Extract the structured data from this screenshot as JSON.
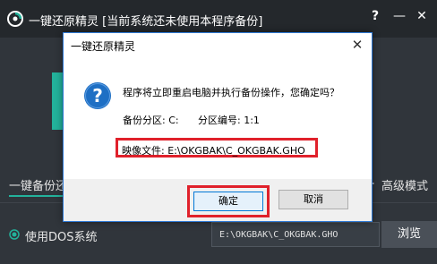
{
  "app": {
    "title": "一键还原精灵 [当前系统还未使用本程序备份]",
    "help_glyph": "?",
    "minimize_glyph": "—",
    "close_glyph": "✕"
  },
  "main": {
    "mode_tab": "一键备份还",
    "advanced_mode": "高级模式",
    "dos_option": "使用DOS系统",
    "image_path": "E:\\OKGBAK\\C_OKGBAK.GHO",
    "browse_label": "浏览"
  },
  "dialog": {
    "title": "一键还原精灵",
    "close_glyph": "✕",
    "message": "程序将立即重启电脑并执行备份操作，您确定吗？",
    "partition": "备份分区: C:",
    "partition_number": "分区编号: 1:1",
    "image_file": "映像文件: E:\\OKGBAK\\C_OKGBAK.GHO",
    "ok_label": "确定",
    "cancel_label": "取消"
  },
  "icons": {
    "app_logo": "app-logo-icon",
    "question": "question-icon",
    "gear": "gear-icon",
    "radio": "radio-checked-icon"
  },
  "colors": {
    "accent": "#23b29b",
    "highlight_red": "#e0212b",
    "question_blue": "#1e6fc4",
    "dialog_border": "#2f7ad6"
  }
}
